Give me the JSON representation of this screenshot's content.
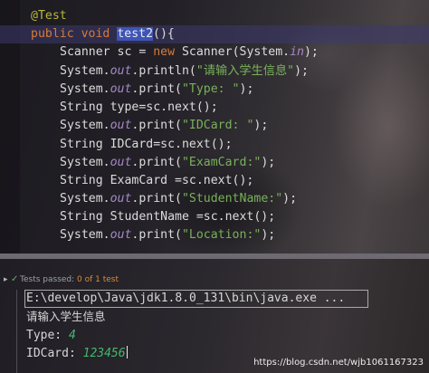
{
  "editor": {
    "lines": [
      {
        "segments": [
          {
            "t": "@Test",
            "c": "a"
          }
        ]
      },
      {
        "segments": [
          {
            "t": "public",
            "c": "k"
          },
          {
            "t": " ",
            "c": "p"
          },
          {
            "t": "void",
            "c": "k"
          },
          {
            "t": " ",
            "c": "p"
          },
          {
            "t": "test2",
            "c": "sel"
          },
          {
            "t": "(){",
            "c": "p"
          }
        ]
      },
      {
        "segments": [
          {
            "t": "Scanner sc = ",
            "c": "p"
          },
          {
            "t": "new",
            "c": "k"
          },
          {
            "t": " Scanner(System.",
            "c": "p"
          },
          {
            "t": "in",
            "c": "f"
          },
          {
            "t": ");",
            "c": "p"
          }
        ]
      },
      {
        "segments": [
          {
            "t": "System.",
            "c": "p"
          },
          {
            "t": "out",
            "c": "f"
          },
          {
            "t": ".println(",
            "c": "p"
          },
          {
            "t": "\"请输入学生信息\"",
            "c": "s"
          },
          {
            "t": ");",
            "c": "p"
          }
        ]
      },
      {
        "segments": [
          {
            "t": "System.",
            "c": "p"
          },
          {
            "t": "out",
            "c": "f"
          },
          {
            "t": ".print(",
            "c": "p"
          },
          {
            "t": "\"Type: \"",
            "c": "s"
          },
          {
            "t": ");",
            "c": "p"
          }
        ]
      },
      {
        "segments": [
          {
            "t": "String type=sc.next();",
            "c": "p"
          }
        ]
      },
      {
        "segments": [
          {
            "t": "System.",
            "c": "p"
          },
          {
            "t": "out",
            "c": "f"
          },
          {
            "t": ".print(",
            "c": "p"
          },
          {
            "t": "\"IDCard: \"",
            "c": "s"
          },
          {
            "t": ");",
            "c": "p"
          }
        ]
      },
      {
        "segments": [
          {
            "t": "String IDCard=sc.next();",
            "c": "p"
          }
        ]
      },
      {
        "segments": [
          {
            "t": "System.",
            "c": "p"
          },
          {
            "t": "out",
            "c": "f"
          },
          {
            "t": ".print(",
            "c": "p"
          },
          {
            "t": "\"ExamCard:\"",
            "c": "s"
          },
          {
            "t": ");",
            "c": "p"
          }
        ]
      },
      {
        "segments": [
          {
            "t": "String ExamCard =sc.next();",
            "c": "p"
          }
        ]
      },
      {
        "segments": [
          {
            "t": "System.",
            "c": "p"
          },
          {
            "t": "out",
            "c": "f"
          },
          {
            "t": ".print(",
            "c": "p"
          },
          {
            "t": "\"StudentName:\"",
            "c": "s"
          },
          {
            "t": ");",
            "c": "p"
          }
        ]
      },
      {
        "segments": [
          {
            "t": "String StudentName =sc.next();",
            "c": "p"
          }
        ]
      },
      {
        "segments": [
          {
            "t": "System.",
            "c": "p"
          },
          {
            "t": "out",
            "c": "f"
          },
          {
            "t": ".print(",
            "c": "p"
          },
          {
            "t": "\"Location:\"",
            "c": "s"
          },
          {
            "t": ");",
            "c": "p"
          }
        ]
      }
    ]
  },
  "status": {
    "prefix": "Tests passed: ",
    "count": "0 of 1 test"
  },
  "console": {
    "command": "E:\\develop\\Java\\jdk1.8.0_131\\bin\\java.exe ...",
    "output_prompt": "请输入学生信息",
    "type_label": "Type: ",
    "type_value": "4",
    "idcard_label": "IDCard: ",
    "idcard_value": "123456"
  },
  "watermark": "https://blog.csdn.net/wjb1061167323",
  "colors": {
    "keyword": "#d47b3a",
    "string": "#79b15a",
    "field": "#a888c8",
    "annotation": "#b7b73b",
    "selection": "#3e54b6",
    "user_input": "#43b86a",
    "test_count": "#d98a3a",
    "pass_check": "#5fb65f"
  }
}
